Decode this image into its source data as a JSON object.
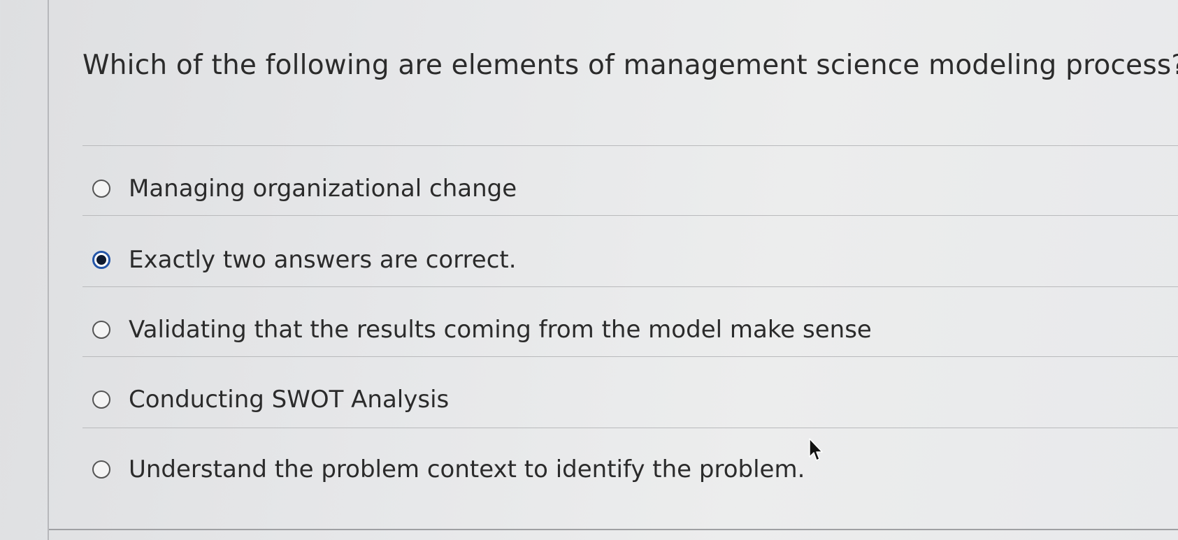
{
  "question": {
    "text": "Which of the following are elements of management science modeling process?"
  },
  "options": [
    {
      "label": "Managing organizational change",
      "selected": false
    },
    {
      "label": "Exactly two answers are correct.",
      "selected": true
    },
    {
      "label": "Validating that the results coming from the model make sense",
      "selected": false
    },
    {
      "label": "Conducting SWOT Analysis",
      "selected": false
    },
    {
      "label": "Understand the problem context to identify the problem.",
      "selected": false
    }
  ],
  "icons": {
    "cursor": "mouse-pointer-icon"
  },
  "colors": {
    "selected_ring": "#2456a8",
    "selected_dot": "#0f1a2e"
  }
}
